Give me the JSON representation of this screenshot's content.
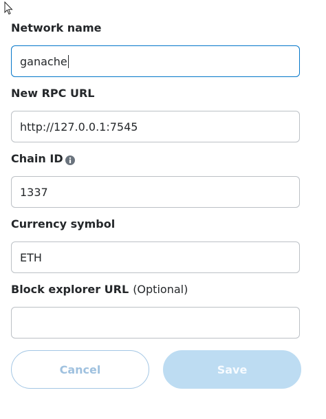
{
  "form": {
    "network_name": {
      "label": "Network name",
      "value": "ganache"
    },
    "rpc_url": {
      "label": "New RPC URL",
      "value": "http://127.0.0.1:7545"
    },
    "chain_id": {
      "label": "Chain ID",
      "value": "1337",
      "info_icon": "info-icon"
    },
    "currency_symbol": {
      "label": "Currency symbol",
      "value": "ETH"
    },
    "block_explorer": {
      "label": "Block explorer URL",
      "optional_label": "(Optional)",
      "value": ""
    }
  },
  "buttons": {
    "cancel_label": "Cancel",
    "save_label": "Save"
  },
  "colors": {
    "focus_border": "#0376c9",
    "input_border": "#bbc0c5",
    "cancel_text": "#9fc1df",
    "save_bg_disabled": "#bddcf2",
    "text": "#24272a"
  }
}
